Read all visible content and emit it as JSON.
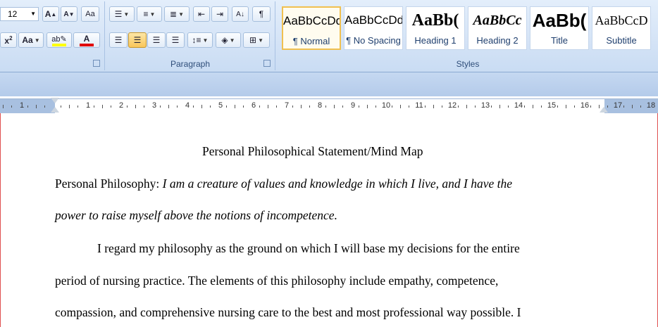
{
  "font": {
    "size": "12"
  },
  "paragraph_group_label": "Paragraph",
  "styles_group_label": "Styles",
  "styles": [
    {
      "sample": "AaBbCcDd",
      "name": "¶ Normal"
    },
    {
      "sample": "AaBbCcDd",
      "name": "¶ No Spacing"
    },
    {
      "sample": "AaBb(",
      "name": "Heading 1"
    },
    {
      "sample": "AaBbCc",
      "name": "Heading 2"
    },
    {
      "sample": "AaBb(",
      "name": "Title"
    },
    {
      "sample": "AaBbCcD",
      "name": "Subtitle"
    }
  ],
  "ruler_numbers": [
    "1",
    "1",
    "2",
    "3",
    "4",
    "5",
    "6",
    "7",
    "8",
    "9",
    "10",
    "11",
    "12",
    "13",
    "14",
    "15",
    "16",
    "17",
    "18"
  ],
  "document": {
    "title": "Personal Philosophical Statement/Mind Map",
    "philosophy_label": "Personal Philosophy:",
    "philosophy_line1": "I am a creature of values and knowledge in which I live, and I have the",
    "philosophy_line2": "power to raise myself above the notions of incompetence.",
    "para_line1": "I regard my philosophy as the ground on which I will base my decisions for the entire",
    "para_line2": "period of nursing practice. The elements of this philosophy include empathy, competence,",
    "para_line3": "compassion, and comprehensive nursing care to the best and most professional way possible. I"
  },
  "colors": {
    "highlight": "#ffff00",
    "font_color": "#e00000",
    "accent": "#f0c050"
  }
}
